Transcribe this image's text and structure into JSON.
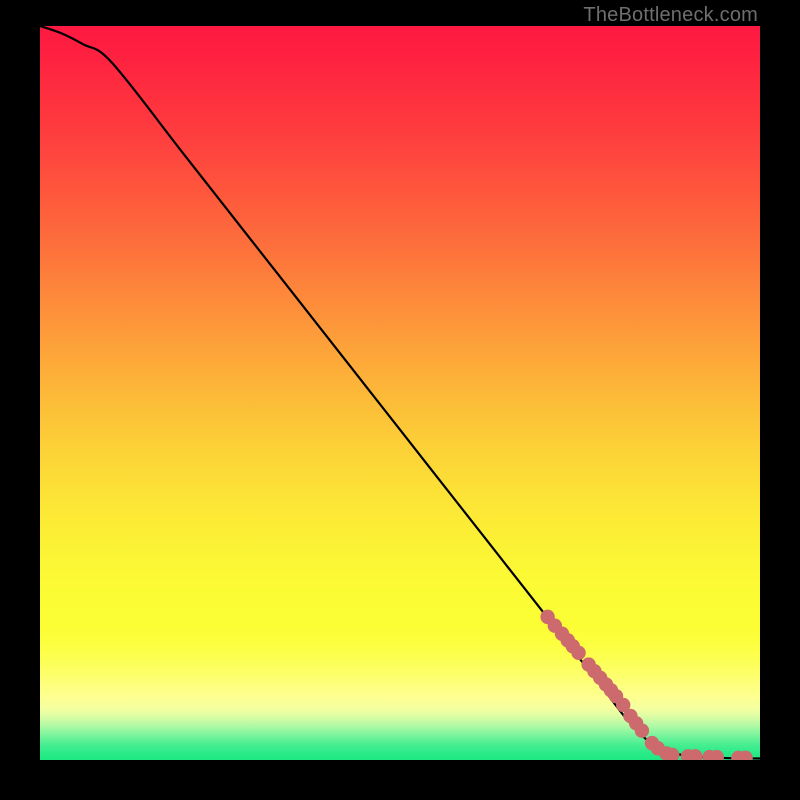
{
  "watermark": {
    "text": "TheBottleneck.com"
  },
  "chart_data": {
    "type": "line",
    "title": "",
    "xlabel": "",
    "ylabel": "",
    "xlim": [
      0,
      100
    ],
    "ylim": [
      0,
      100
    ],
    "grid": false,
    "legend": false,
    "series": [
      {
        "name": "bottleneck-curve",
        "color": "#000000",
        "type": "line",
        "x": [
          0,
          3,
          6,
          10,
          20,
          30,
          40,
          50,
          60,
          70,
          78,
          82,
          86,
          90,
          94,
          100
        ],
        "y": [
          100,
          99,
          97.5,
          95,
          82.5,
          70,
          57.5,
          45,
          32.5,
          20,
          10,
          5,
          1.5,
          0.6,
          0.3,
          0.2
        ]
      },
      {
        "name": "curve-markers",
        "color": "#cd6a6d",
        "type": "scatter",
        "x": [
          70.5,
          71.5,
          72.5,
          73.3,
          74.0,
          74.8,
          76.2,
          77.0,
          77.8,
          78.6,
          79.3,
          80.0,
          81.0,
          82.0,
          82.8,
          83.6,
          85.0,
          85.8,
          87.0,
          87.8,
          90.0,
          91.0,
          93.0,
          94.0,
          97.0,
          98.0
        ],
        "y": [
          19.5,
          18.3,
          17.2,
          16.3,
          15.5,
          14.6,
          13.0,
          12.1,
          11.2,
          10.3,
          9.5,
          8.7,
          7.5,
          6.0,
          5.0,
          4.0,
          2.3,
          1.6,
          0.9,
          0.7,
          0.5,
          0.5,
          0.4,
          0.4,
          0.3,
          0.3
        ]
      }
    ],
    "gradient_stops": [
      {
        "offset": 0.0,
        "color": "#fe1940"
      },
      {
        "offset": 0.04,
        "color": "#fe2140"
      },
      {
        "offset": 0.08,
        "color": "#fe2b3f"
      },
      {
        "offset": 0.12,
        "color": "#fe363e"
      },
      {
        "offset": 0.16,
        "color": "#fe413e"
      },
      {
        "offset": 0.2,
        "color": "#fe4e3d"
      },
      {
        "offset": 0.24,
        "color": "#fe5b3c"
      },
      {
        "offset": 0.28,
        "color": "#fd693c"
      },
      {
        "offset": 0.32,
        "color": "#fd773b"
      },
      {
        "offset": 0.36,
        "color": "#fd863b"
      },
      {
        "offset": 0.4,
        "color": "#fd943a"
      },
      {
        "offset": 0.44,
        "color": "#fda339"
      },
      {
        "offset": 0.48,
        "color": "#fdb139"
      },
      {
        "offset": 0.52,
        "color": "#fcbf38"
      },
      {
        "offset": 0.56,
        "color": "#fccc37"
      },
      {
        "offset": 0.6,
        "color": "#fcd837"
      },
      {
        "offset": 0.64,
        "color": "#fce336"
      },
      {
        "offset": 0.68,
        "color": "#fcec35"
      },
      {
        "offset": 0.72,
        "color": "#fbf435"
      },
      {
        "offset": 0.76,
        "color": "#fbfa34"
      },
      {
        "offset": 0.8,
        "color": "#fbfe34"
      },
      {
        "offset": 0.82,
        "color": "#fbfe35"
      },
      {
        "offset": 0.84,
        "color": "#fcff3e"
      },
      {
        "offset": 0.86,
        "color": "#fcff4f"
      },
      {
        "offset": 0.88,
        "color": "#fdff66"
      },
      {
        "offset": 0.9,
        "color": "#fdff80"
      },
      {
        "offset": 0.915,
        "color": "#fdff91"
      },
      {
        "offset": 0.93,
        "color": "#f4ff9f"
      },
      {
        "offset": 0.94,
        "color": "#ddfda4"
      },
      {
        "offset": 0.95,
        "color": "#bdfaa5"
      },
      {
        "offset": 0.96,
        "color": "#95f7a1"
      },
      {
        "offset": 0.97,
        "color": "#6bf29a"
      },
      {
        "offset": 0.98,
        "color": "#45ee90"
      },
      {
        "offset": 0.99,
        "color": "#2aea88"
      },
      {
        "offset": 1.0,
        "color": "#1ee883"
      }
    ]
  }
}
